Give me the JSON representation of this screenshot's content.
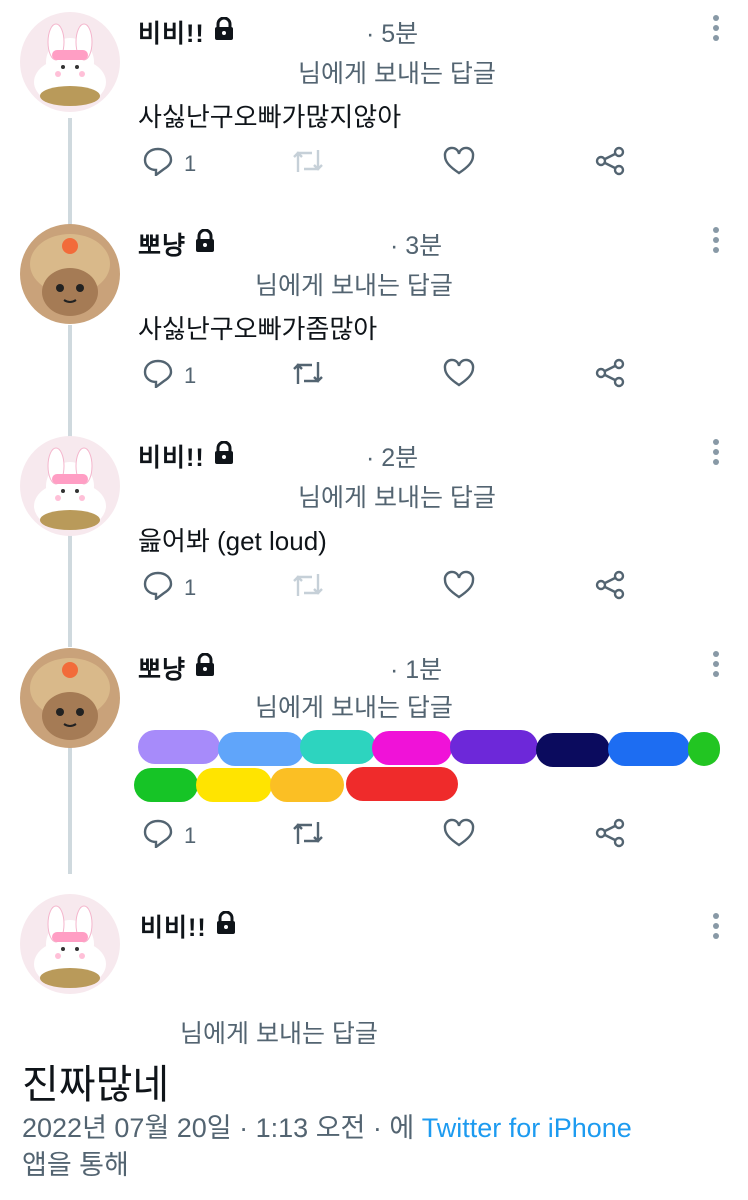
{
  "colors": {
    "text": "#0f1419",
    "secondary": "#536471",
    "link": "#1d9bf0",
    "thread_line": "#cfd9de"
  },
  "tweets": [
    {
      "name": "비비!!",
      "time": "· 5분",
      "reply_to": "님에게 보내는 답글",
      "text": "사싫난구오빠가많지않아",
      "replies": "1",
      "avatar": "bunny-avatar"
    },
    {
      "name": "뽀냥",
      "time": "· 3분",
      "reply_to": "님에게 보내는 답글",
      "text": "사싫난구오빠가좀많아",
      "replies": "1",
      "avatar": "cat-avatar"
    },
    {
      "name": "비비!!",
      "time": "· 2분",
      "reply_to": "님에게 보내는 답글",
      "text": "읊어봐 (get loud)",
      "replies": "1",
      "avatar": "bunny-avatar"
    },
    {
      "name": "뽀냥",
      "time": "· 1분",
      "reply_to": "님에게 보내는 답글",
      "text": "",
      "replies": "1",
      "avatar": "cat-avatar"
    }
  ],
  "scribbles": [
    "#a78bfa",
    "#60a5fa",
    "#2dd4bf",
    "#f012d8",
    "#6d28d9",
    "#0b0b5e",
    "#1d6df2",
    "#22c522",
    "#16c426",
    "#ffe400",
    "#fbbf24",
    "#ef2b2b"
  ],
  "main_tweet": {
    "name": "비비!!",
    "reply_to": "님에게 보내는 답글",
    "text": "진짜많네",
    "meta_date": "2022년 07월 20일 · 1:13 오전 · 에",
    "meta_source": "Twitter for iPhone",
    "meta_suffix": "앱을 통해"
  },
  "icons": [
    "lock-icon",
    "more-icon",
    "reply-icon",
    "retweet-icon",
    "like-icon",
    "share-icon"
  ]
}
